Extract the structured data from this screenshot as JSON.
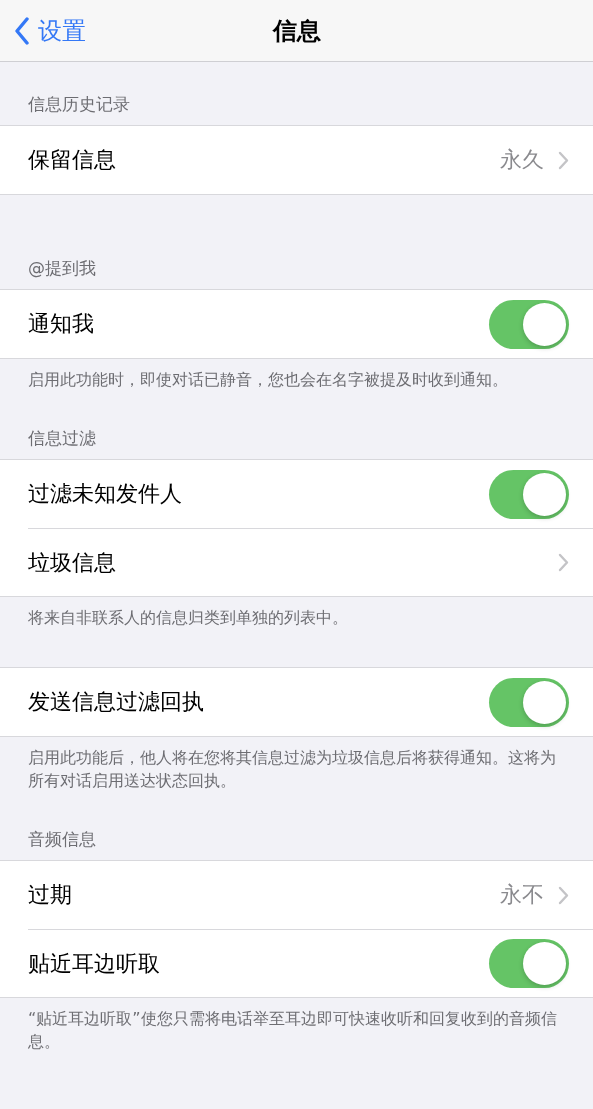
{
  "nav": {
    "back": "设置",
    "title": "信息"
  },
  "sections": [
    {
      "header": "信息历史记录",
      "rows": [
        {
          "kind": "value",
          "label": "保留信息",
          "value": "永久"
        }
      ]
    },
    {
      "header": "@提到我",
      "rows": [
        {
          "kind": "toggle",
          "label": "通知我",
          "on": true
        }
      ],
      "footer": "启用此功能时，即使对话已静音，您也会在名字被提及时收到通知。"
    },
    {
      "header": "信息过滤",
      "rows": [
        {
          "kind": "toggle",
          "label": "过滤未知发件人",
          "on": true
        },
        {
          "kind": "value",
          "label": "垃圾信息"
        }
      ],
      "footer": "将来自非联系人的信息归类到单独的列表中。"
    },
    {
      "rows": [
        {
          "kind": "toggle",
          "label": "发送信息过滤回执",
          "on": true
        }
      ],
      "footer": "启用此功能后，他人将在您将其信息过滤为垃圾信息后将获得通知。这将为所有对话启用送达状态回执。"
    },
    {
      "header": "音频信息",
      "rows": [
        {
          "kind": "value",
          "label": "过期",
          "value": "永不"
        },
        {
          "kind": "toggle",
          "label": "贴近耳边听取",
          "on": true
        }
      ],
      "footer": "“贴近耳边听取”使您只需将电话举至耳边即可快速收听和回复收到的音频信息。"
    }
  ]
}
